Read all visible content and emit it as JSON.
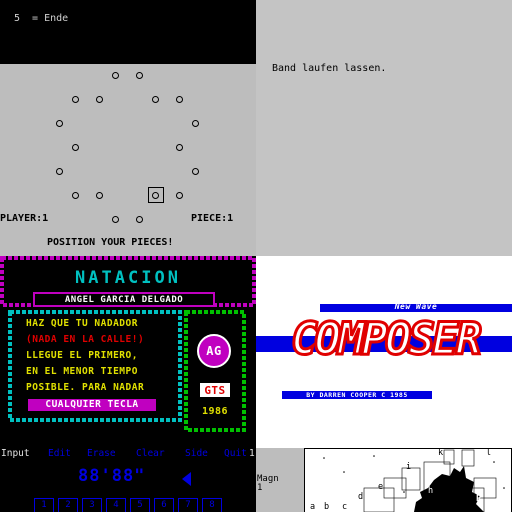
{
  "quadrant_tl": {
    "menu_text": "5  = Ende",
    "player_label": "PLAYER:1",
    "piece_label": "PIECE:1",
    "instruction": "POSITION YOUR PIECES!"
  },
  "quadrant_tr": {
    "message": "Band laufen lassen."
  },
  "quadrant_bl": {
    "title": "NATACION",
    "author": "ANGEL GARCIA DELGADO",
    "lines": [
      "HAZ QUE TU NADADOR",
      "(NADA EN LA CALLE!)",
      "LLEGUE EL PRIMERO,",
      "EN EL MENOR TIEMPO",
      "POSIBLE. PARA NADAR"
    ],
    "key_prompt": "CUALQUIER TECLA",
    "logo_initials": "AG",
    "logo_brand": "GTS",
    "year": "1986"
  },
  "quadrant_br": {
    "subtitle": "New Wave",
    "title": "COMPOSER",
    "credit": "BY DARREN COOPER C 1985"
  },
  "strip_left": {
    "menu": [
      {
        "label": "Input"
      },
      {
        "label": "Edit"
      },
      {
        "label": "Erase"
      },
      {
        "label": "Clear"
      },
      {
        "label": "Side"
      },
      {
        "label": "Quit"
      }
    ],
    "edge_digit": "1",
    "time": "88'88\"",
    "slots": [
      "1",
      "2",
      "3",
      "4",
      "5",
      "6",
      "7",
      "8"
    ]
  },
  "strip_right": {
    "magn_label": "Magn",
    "magn_value": "1",
    "letters": [
      "a",
      "b",
      "c",
      "d",
      "e",
      "h",
      "i",
      "k",
      "l",
      "P"
    ]
  },
  "colors": {
    "board_grey": "#bdbdbd",
    "msg_grey": "#c4c4c4",
    "magenta": "#c000c0",
    "cyan": "#00c0c0",
    "green": "#00c000",
    "yellow": "#e0e000",
    "red": "#e00000",
    "blue": "#0000e0"
  }
}
